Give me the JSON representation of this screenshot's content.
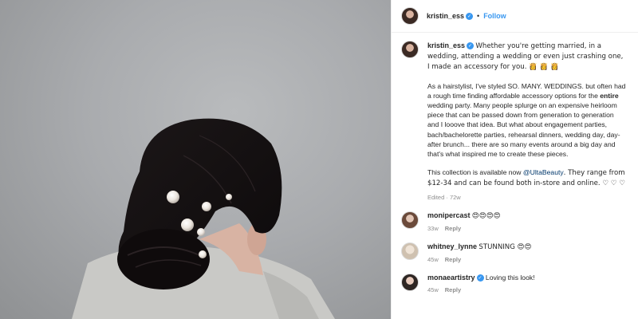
{
  "header": {
    "username": "kristin_ess",
    "dot": "•",
    "follow_label": "Follow"
  },
  "post": {
    "username": "kristin_ess",
    "para1": "Whether you're getting married, in a wedding, attending a wedding or even just crashing one, I made an accessory for you. 👸 👸 👸",
    "para2_a": "As a hairstylist, I've styled SO. MANY. WEDDINGS. but often had a rough time finding affordable accessory options for the ",
    "para2_bold": "entire",
    "para2_b": " wedding party. Many people splurge on an expensive heirloom piece that can be passed down from generation to generation and I looove that idea. But what about engagement parties, bach/bachelorette parties, rehearsal dinners, wedding day, day-after brunch... there are so many events around a big day and that's what inspired me to create these pieces.",
    "para3_a": "This collection is available now ",
    "para3_mention": "@UltaBeauty",
    "para3_b": ". They range from $12-34 and can be found both in-store and online. ♡ ♡ ♡",
    "edited": "Edited",
    "time": "72w"
  },
  "comments": [
    {
      "username": "monipercast",
      "text": "😍😍😍😍",
      "time": "33w",
      "reply": "Reply"
    },
    {
      "username": "whitney_lynne",
      "text": "STUNNING 😍😍",
      "time": "45w",
      "reply": "Reply"
    },
    {
      "username": "monaeartistry",
      "text": "Loving this look!",
      "time": "45w",
      "reply": "Reply"
    }
  ],
  "colors": {
    "accent": "#3897f0",
    "secondary_text": "#8e8e8e"
  }
}
